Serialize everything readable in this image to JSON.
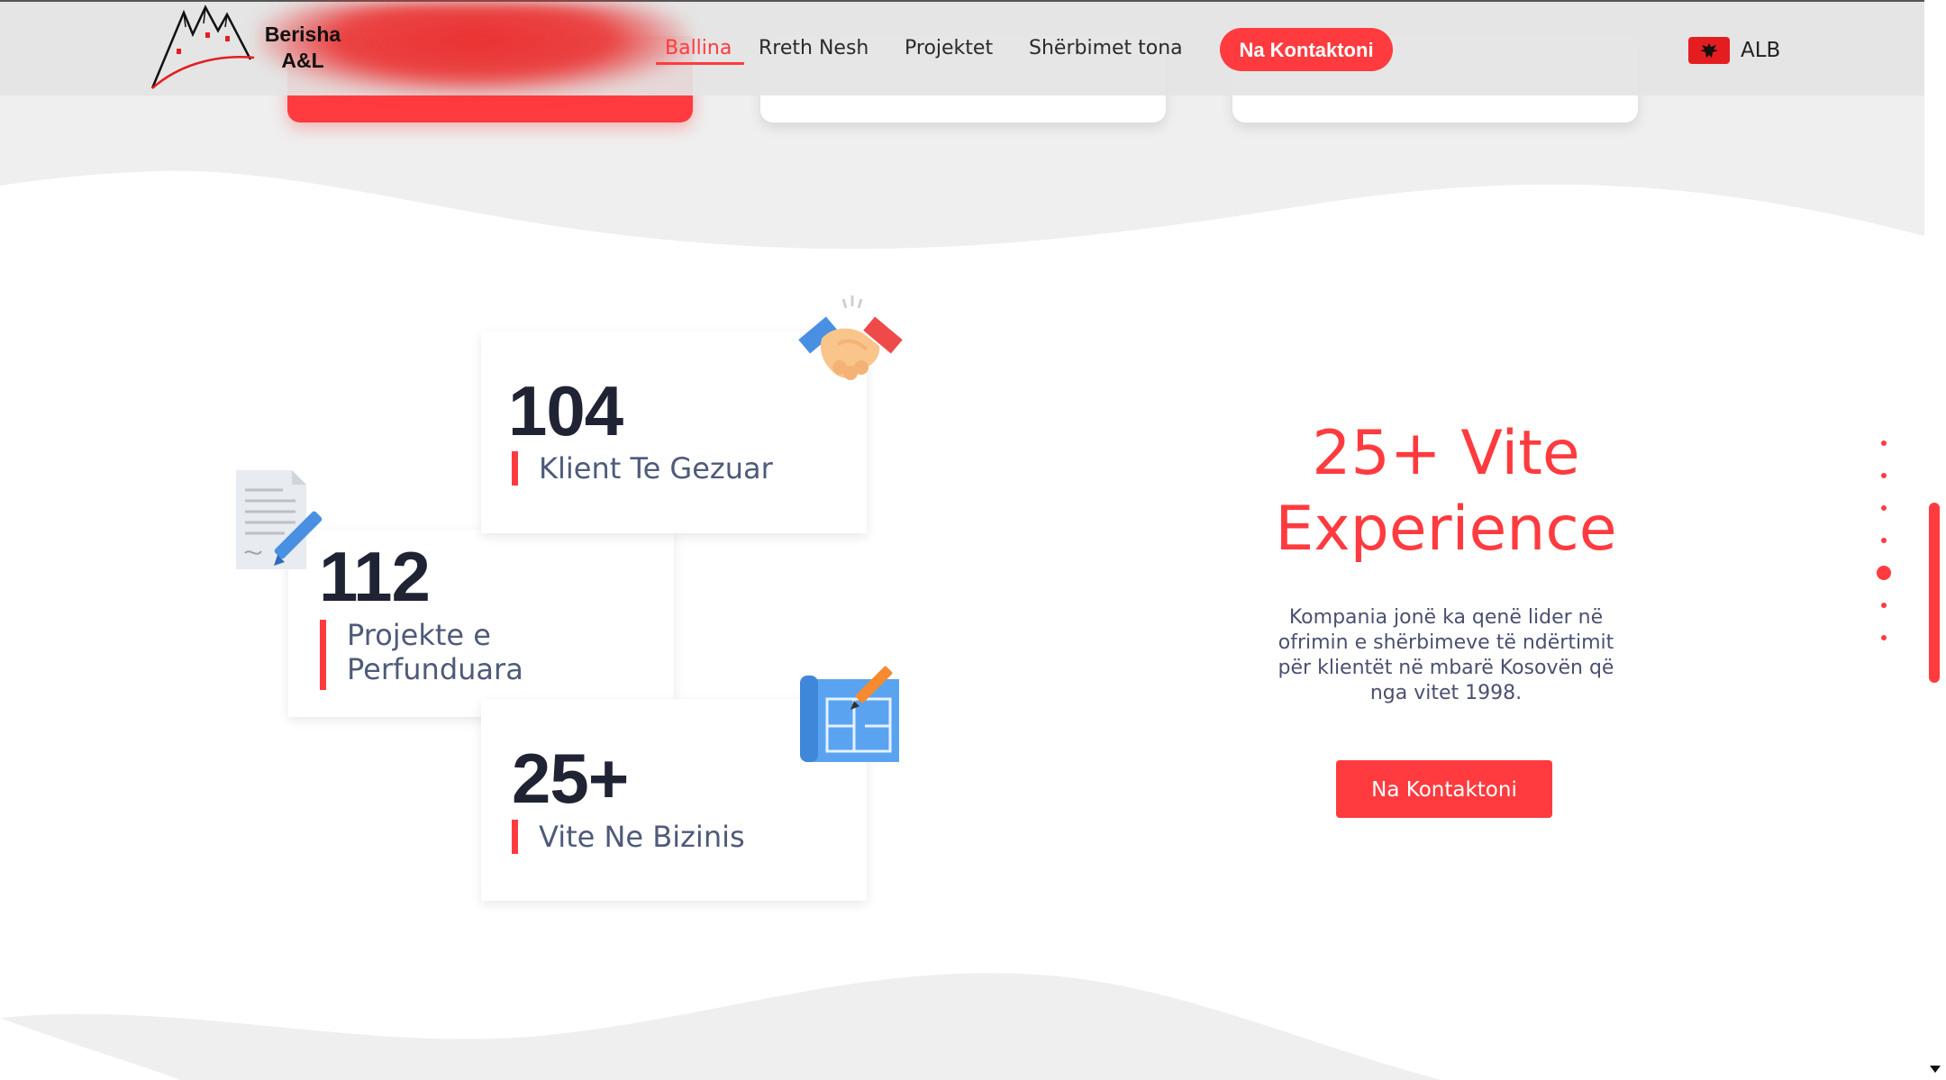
{
  "brand": {
    "name_line1": "Berisha",
    "name_line2": "A&L"
  },
  "nav": {
    "items": [
      {
        "label": "Ballina",
        "active": true
      },
      {
        "label": "Rreth Nesh",
        "active": false
      },
      {
        "label": "Projektet",
        "active": false
      },
      {
        "label": "Shërbimet tona",
        "active": false
      }
    ],
    "cta_label": "Na Kontaktoni",
    "language_label": "ALB"
  },
  "stats": [
    {
      "number": "104",
      "label": "Klient Te Gezuar",
      "icon": "handshake-icon"
    },
    {
      "number": "112",
      "label": "Projekte e Perfunduara",
      "icon": "contract-icon"
    },
    {
      "number": "25+",
      "label": "Vite Ne Bizinis",
      "icon": "blueprint-icon"
    }
  ],
  "experience": {
    "title": "25+ Vite Experience",
    "description": "Kompania jonë ka qenë lider në ofrimin e shërbimeve të ndërtimit për klientët në mbarë Kosovën që nga vitet 1998.",
    "button_label": "Na Kontaktoni"
  },
  "section_nav": {
    "dot_count": 7,
    "active_index": 4
  },
  "colors": {
    "accent": "#ff3b3f",
    "text_dark": "#1f2333",
    "text_muted": "#4e5a7a",
    "header_bg": "#e4e4e4",
    "wave_gray": "#efefef"
  }
}
